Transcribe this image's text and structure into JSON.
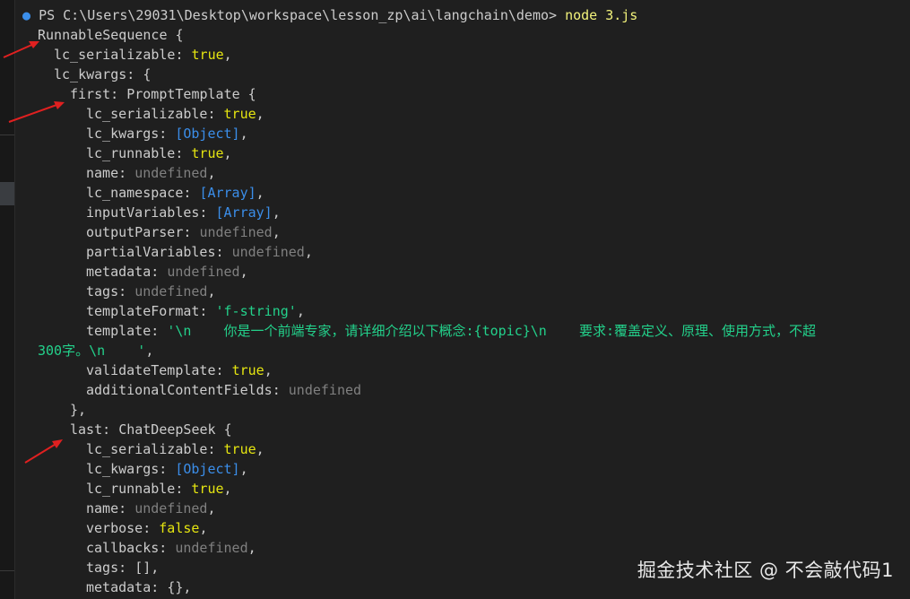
{
  "terminal": {
    "cut_top_line": "PS C:\\Users\\29031\\Desktop\\workspace\\lesson_zp\\ai\\langchain\\demo> node 3.js",
    "prompt_path": "PS C:\\Users\\29031\\Desktop\\workspace\\lesson_zp\\ai\\langchain\\demo>",
    "command": "node 3.js",
    "lines": {
      "l1": "RunnableSequence {",
      "l2_key": "lc_serializable: ",
      "l2_val": "true",
      "l2_end": ",",
      "l3": "lc_kwargs: {",
      "l4_key": "first: ",
      "l4_cls": "PromptTemplate {",
      "l5_key": "lc_serializable: ",
      "l5_val": "true",
      "l5_end": ",",
      "l6_key": "lc_kwargs: ",
      "l6_val": "[Object]",
      "l6_end": ",",
      "l7_key": "lc_runnable: ",
      "l7_val": "true",
      "l7_end": ",",
      "l8_key": "name: ",
      "l8_val": "undefined",
      "l8_end": ",",
      "l9_key": "lc_namespace: ",
      "l9_val": "[Array]",
      "l9_end": ",",
      "l10_key": "inputVariables: ",
      "l10_val": "[Array]",
      "l10_end": ",",
      "l11_key": "outputParser: ",
      "l11_val": "undefined",
      "l11_end": ",",
      "l12_key": "partialVariables: ",
      "l12_val": "undefined",
      "l12_end": ",",
      "l13_key": "metadata: ",
      "l13_val": "undefined",
      "l13_end": ",",
      "l14_key": "tags: ",
      "l14_val": "undefined",
      "l14_end": ",",
      "l15_key": "templateFormat: ",
      "l15_val": "'f-string'",
      "l15_end": ",",
      "l16_key": "template: ",
      "l16_val": "'\\n    你是一个前端专家，请详细介绍以下概念:{topic}\\n    要求:覆盖定义、原理、使用方式，不超",
      "l17_val": "300字。\\n    '",
      "l17_end": ",",
      "l18_key": "validateTemplate: ",
      "l18_val": "true",
      "l18_end": ",",
      "l19_key": "additionalContentFields: ",
      "l19_val": "undefined",
      "l20": "},",
      "l21_key": "last: ",
      "l21_cls": "ChatDeepSeek {",
      "l22_key": "lc_serializable: ",
      "l22_val": "true",
      "l22_end": ",",
      "l23_key": "lc_kwargs: ",
      "l23_val": "[Object]",
      "l23_end": ",",
      "l24_key": "lc_runnable: ",
      "l24_val": "true",
      "l24_end": ",",
      "l25_key": "name: ",
      "l25_val": "undefined",
      "l25_end": ",",
      "l26_key": "verbose: ",
      "l26_val": "false",
      "l26_end": ",",
      "l27_key": "callbacks: ",
      "l27_val": "undefined",
      "l27_end": ",",
      "l28_key": "tags: ",
      "l28_val": "[]",
      "l28_end": ",",
      "l29_key": "metadata: ",
      "l29_val": "{}",
      "l29_end": ","
    }
  },
  "watermark": "掘金技术社区 @ 不会敲代码1",
  "colors": {
    "background": "#1f1f1f",
    "boolean": "#e5e510",
    "reference": "#3b8eea",
    "string": "#23d18b",
    "undefined": "#808080",
    "arrow": "#e02020"
  },
  "icons": [
    "arrow-annotation-icon",
    "prompt-dot-icon"
  ]
}
